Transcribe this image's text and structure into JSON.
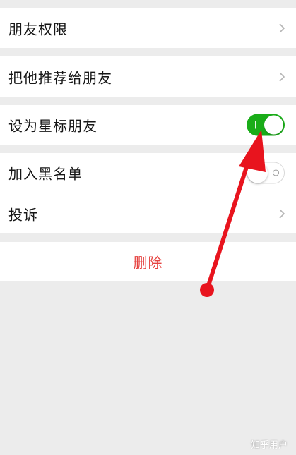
{
  "settings": {
    "friend_permissions": "朋友权限",
    "recommend_to_friend": "把他推荐给朋友",
    "star_friend": {
      "label": "设为星标朋友",
      "enabled": true
    },
    "blacklist": {
      "label": "加入黑名单",
      "enabled": false
    },
    "complain": "投诉"
  },
  "actions": {
    "delete_label": "删除"
  },
  "watermark": "知乎用户",
  "colors": {
    "switch_on": "#1aad19",
    "delete_text": "#e64340",
    "annotation_arrow": "#e8141e",
    "background": "#ececec"
  }
}
